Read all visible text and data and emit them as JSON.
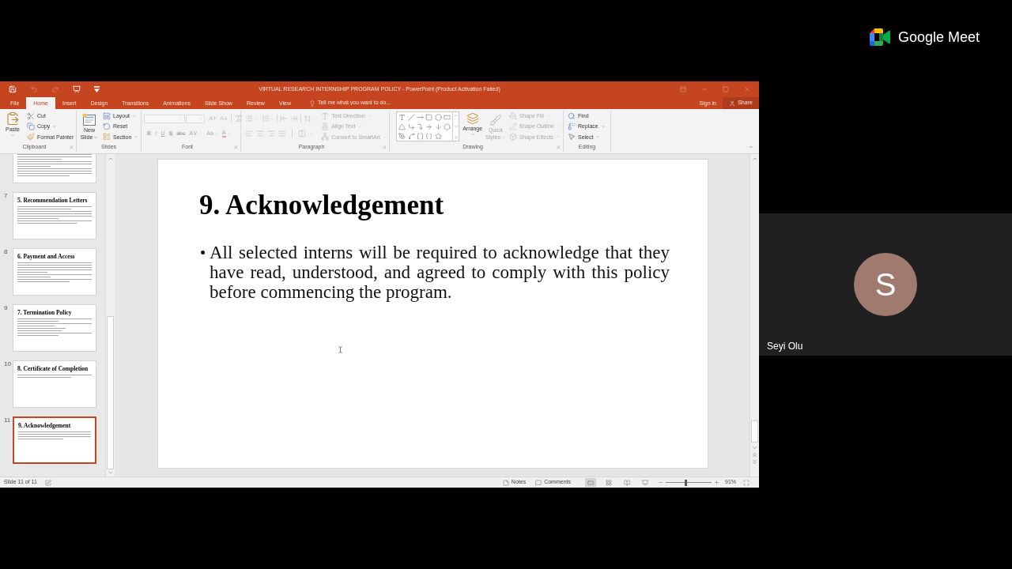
{
  "meet": {
    "brand": "Google Meet",
    "participant": {
      "initial": "S",
      "name": "Seyi Olu"
    }
  },
  "quick_access": [
    {
      "kind": "save",
      "disabled": false
    },
    {
      "kind": "undo",
      "disabled": true
    },
    {
      "kind": "redo",
      "disabled": true
    },
    {
      "kind": "present",
      "disabled": false
    },
    {
      "kind": "customize",
      "disabled": false
    }
  ],
  "window": {
    "title": "VIRTUAL RESEARCH INTERNSHIP PROGRAM POLICY - PowerPoint (Product Activation Failed)"
  },
  "tabs": [
    {
      "label": "File",
      "selected": false
    },
    {
      "label": "Home",
      "selected": true
    },
    {
      "label": "Insert",
      "selected": false
    },
    {
      "label": "Design",
      "selected": false
    },
    {
      "label": "Transitions",
      "selected": false
    },
    {
      "label": "Animations",
      "selected": false
    },
    {
      "label": "Slide Show",
      "selected": false
    },
    {
      "label": "Review",
      "selected": false
    },
    {
      "label": "View",
      "selected": false
    }
  ],
  "tell_me": {
    "placeholder": "Tell me what you want to do..."
  },
  "account": {
    "sign_in": "Sign in",
    "share": "Share"
  },
  "ribbon": {
    "clipboard": {
      "label": "Clipboard",
      "paste": "Paste",
      "commands": [
        {
          "kind": "cut",
          "label": "Cut"
        },
        {
          "kind": "copy",
          "label": "Copy"
        },
        {
          "kind": "painter",
          "label": "Format Painter"
        }
      ]
    },
    "slides": {
      "label": "Slides",
      "new_slide": "New Slide",
      "commands": [
        {
          "kind": "layout",
          "label": "Layout"
        },
        {
          "kind": "reset",
          "label": "Reset"
        },
        {
          "kind": "section",
          "label": "Section"
        }
      ]
    },
    "font": {
      "label": "Font",
      "disabled": true,
      "format_buttons": [
        {
          "kind": "bold",
          "text": "B"
        },
        {
          "kind": "italic",
          "text": "I"
        },
        {
          "kind": "underline",
          "text": "U"
        },
        {
          "kind": "shadow",
          "text": "S"
        },
        {
          "kind": "strike",
          "text": "abc"
        },
        {
          "kind": "spacing",
          "text": "AV"
        },
        {
          "kind": "case",
          "text": "Aa"
        },
        {
          "kind": "color",
          "text": "A"
        }
      ]
    },
    "paragraph": {
      "label": "Paragraph",
      "disabled": true,
      "commands": [
        {
          "kind": "direction",
          "label": "Text Direction"
        },
        {
          "kind": "align",
          "label": "Align Text"
        },
        {
          "kind": "smartart",
          "label": "Convert to SmartArt"
        }
      ]
    },
    "drawing": {
      "label": "Drawing",
      "arrange": "Arrange",
      "quick_styles": {
        "label": "Quick Styles",
        "disabled": true
      },
      "commands": [
        {
          "kind": "fill",
          "label": "Shape Fill",
          "disabled": true
        },
        {
          "kind": "outline",
          "label": "Shape Outline",
          "disabled": true
        },
        {
          "kind": "effects",
          "label": "Shape Effects",
          "disabled": true
        }
      ]
    },
    "editing": {
      "label": "Editing",
      "commands": [
        {
          "kind": "find",
          "label": "Find"
        },
        {
          "kind": "replace",
          "label": "Replace"
        },
        {
          "kind": "select",
          "label": "Select"
        }
      ]
    }
  },
  "thumbnails": [
    {
      "selected": false
    },
    {
      "number": "7",
      "title": "5. Recommendation Letters",
      "selected": false
    },
    {
      "number": "8",
      "title": "6. Payment and Access",
      "selected": false
    },
    {
      "number": "9",
      "title": "7. Termination Policy",
      "selected": false
    },
    {
      "number": "10",
      "title": "8. Certificate of Completion",
      "selected": false
    },
    {
      "number": "11",
      "title": "9. Acknowledgement",
      "selected": true
    }
  ],
  "slide": {
    "title": "9. Acknowledgement",
    "bullets": [
      "All selected interns will be required to acknowledge that they have read, understood, and agreed to comply with this policy before commencing the program."
    ]
  },
  "status": {
    "slide_counter": "Slide 11 of 11",
    "notes": "Notes",
    "comments": "Comments",
    "views": [
      {
        "kind": "normal",
        "selected": true
      },
      {
        "kind": "sorter",
        "selected": false
      },
      {
        "kind": "reading",
        "selected": false
      },
      {
        "kind": "slideshow",
        "selected": false
      }
    ],
    "zoom": {
      "level": 0.44,
      "reading": "91%"
    }
  }
}
